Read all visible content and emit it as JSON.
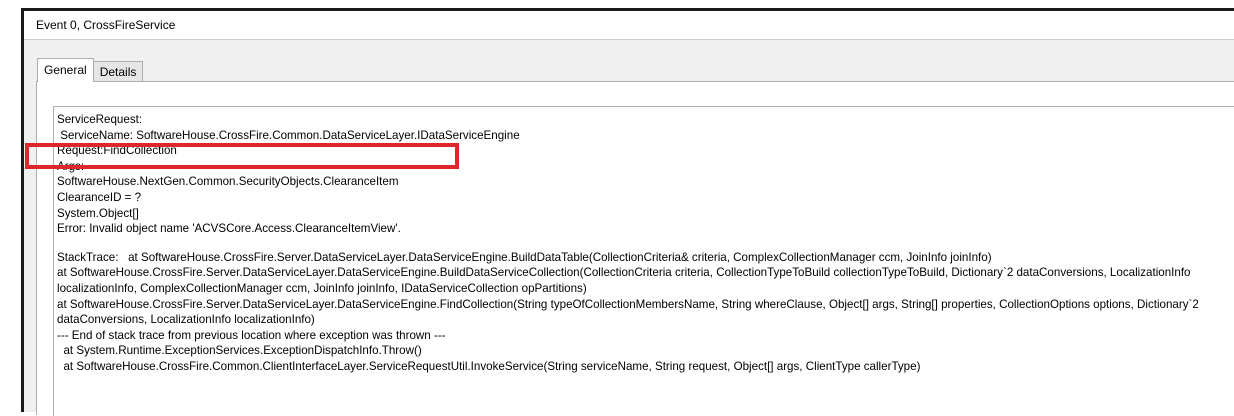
{
  "window": {
    "title": "Event 0, CrossFireService"
  },
  "tabs": [
    {
      "label": "General",
      "active": true
    },
    {
      "label": "Details",
      "active": false
    }
  ],
  "details": {
    "lines": [
      "ServiceRequest:",
      " ServiceName: SoftwareHouse.CrossFire.Common.DataServiceLayer.IDataServiceEngine",
      "Request:FindCollection",
      "Args:",
      "SoftwareHouse.NextGen.Common.SecurityObjects.ClearanceItem",
      "ClearanceID = ?",
      "System.Object[]",
      "Error: Invalid object name 'ACVSCore.Access.ClearanceItemView'."
    ],
    "stack_trace": [
      "StackTrace:   at SoftwareHouse.CrossFire.Server.DataServiceLayer.DataServiceEngine.BuildDataTable(CollectionCriteria& criteria, ComplexCollectionManager ccm, JoinInfo joinInfo)",
      "  at SoftwareHouse.CrossFire.Server.DataServiceLayer.DataServiceEngine.BuildDataServiceCollection(CollectionCriteria criteria, CollectionTypeToBuild collectionTypeToBuild, Dictionary`2 dataConversions, LocalizationInfo localizationInfo, ComplexCollectionManager ccm, JoinInfo joinInfo, IDataServiceCollection opPartitions)",
      "  at SoftwareHouse.CrossFire.Server.DataServiceLayer.DataServiceEngine.FindCollection(String typeOfCollectionMembersName, String whereClause, Object[] args, String[] properties, CollectionOptions options, Dictionary`2 dataConversions, LocalizationInfo localizationInfo)",
      "--- End of stack trace from previous location where exception was thrown ---",
      "  at System.Runtime.ExceptionServices.ExceptionDispatchInfo.Throw()",
      "  at SoftwareHouse.CrossFire.Common.ClientInterfaceLayer.ServiceRequestUtil.InvokeService(String serviceName, String request, Object[] args, ClientType callerType)"
    ]
  },
  "annotation": {
    "color": "#e0262d"
  }
}
